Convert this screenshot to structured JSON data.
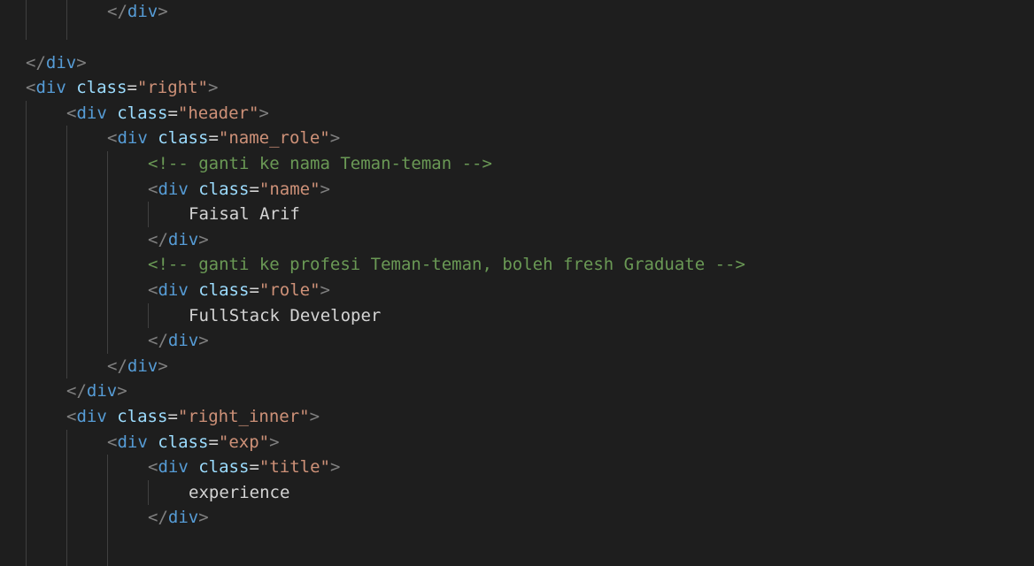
{
  "editor": {
    "lines": [
      {
        "indent": 2,
        "kind": "close",
        "tag": "div"
      },
      {
        "indent": 0,
        "kind": "blank"
      },
      {
        "indent": 0,
        "kind": "close",
        "tag": "div"
      },
      {
        "indent": 0,
        "kind": "open",
        "tag": "div",
        "attr": "class",
        "value": "\"right\""
      },
      {
        "indent": 1,
        "kind": "open",
        "tag": "div",
        "attr": "class",
        "value": "\"header\""
      },
      {
        "indent": 2,
        "kind": "open",
        "tag": "div",
        "attr": "class",
        "value": "\"name_role\""
      },
      {
        "indent": 3,
        "kind": "comment",
        "text": "<!-- ganti ke nama Teman-teman -->"
      },
      {
        "indent": 3,
        "kind": "open",
        "tag": "div",
        "attr": "class",
        "value": "\"name\""
      },
      {
        "indent": 4,
        "kind": "text",
        "text": "Faisal Arif"
      },
      {
        "indent": 3,
        "kind": "close",
        "tag": "div"
      },
      {
        "indent": 3,
        "kind": "comment",
        "text": "<!-- ganti ke profesi Teman-teman, boleh fresh Graduate -->"
      },
      {
        "indent": 3,
        "kind": "open",
        "tag": "div",
        "attr": "class",
        "value": "\"role\""
      },
      {
        "indent": 4,
        "kind": "text",
        "text": "FullStack Developer"
      },
      {
        "indent": 3,
        "kind": "close",
        "tag": "div"
      },
      {
        "indent": 2,
        "kind": "close",
        "tag": "div"
      },
      {
        "indent": 1,
        "kind": "close",
        "tag": "div"
      },
      {
        "indent": 1,
        "kind": "open",
        "tag": "div",
        "attr": "class",
        "value": "\"right_inner\""
      },
      {
        "indent": 2,
        "kind": "open",
        "tag": "div",
        "attr": "class",
        "value": "\"exp\""
      },
      {
        "indent": 3,
        "kind": "open",
        "tag": "div",
        "attr": "class",
        "value": "\"title\""
      },
      {
        "indent": 4,
        "kind": "text",
        "text": "experience"
      },
      {
        "indent": 3,
        "kind": "close",
        "tag": "div"
      }
    ]
  },
  "colors": {
    "background": "#1e1e1e",
    "bracket": "#808080",
    "tag": "#569cd6",
    "attribute": "#9cdcfe",
    "string": "#ce9178",
    "comment": "#6a9955",
    "text": "#d4d4d4",
    "indent_guide": "#404040"
  }
}
